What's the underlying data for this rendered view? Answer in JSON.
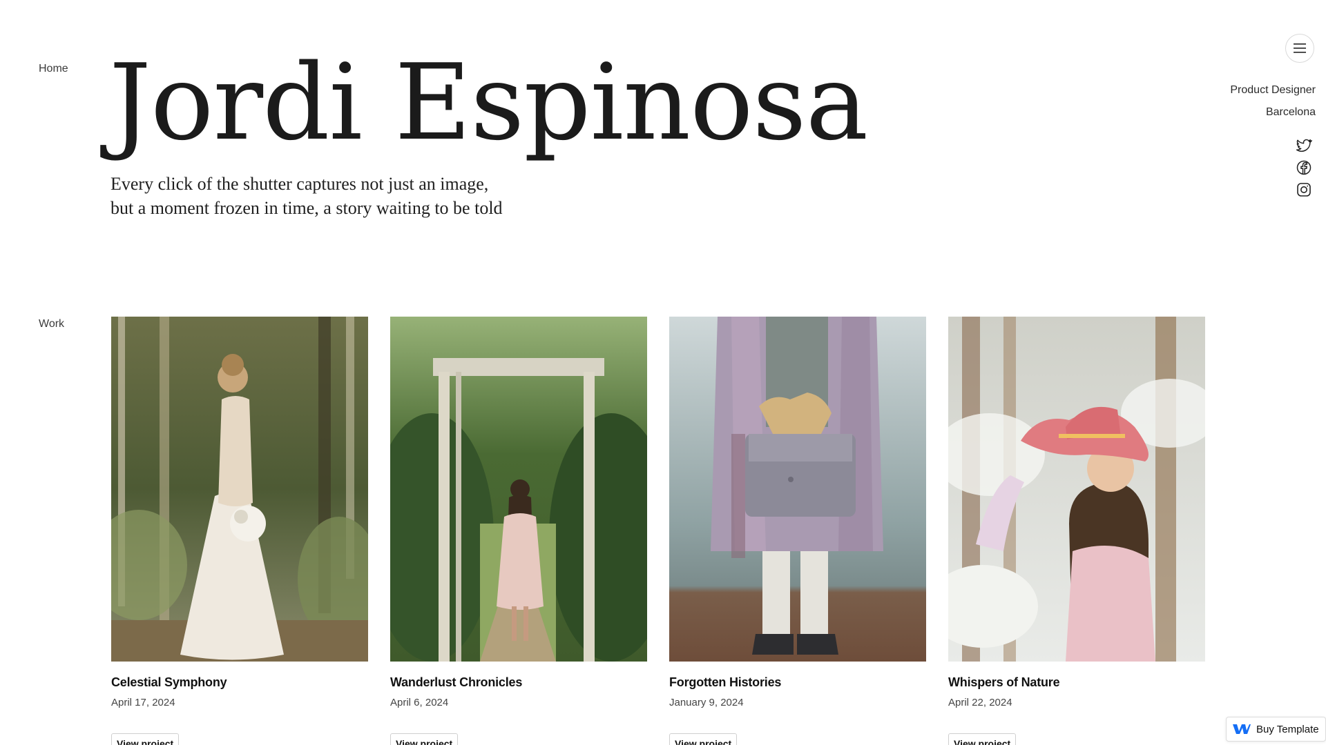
{
  "nav": {
    "home_label": "Home",
    "work_label": "Work",
    "menu_icon": "hamburger-menu-icon"
  },
  "hero": {
    "title": "Jordi Espinosa",
    "tagline_line1": "Every click of the shutter captures not just an image,",
    "tagline_line2": "but a moment frozen in time, a story waiting to be told"
  },
  "profile": {
    "role": "Product Designer",
    "location": "Barcelona"
  },
  "socials": [
    {
      "name": "twitter",
      "icon": "twitter-icon"
    },
    {
      "name": "facebook",
      "icon": "facebook-icon"
    },
    {
      "name": "instagram",
      "icon": "instagram-icon"
    }
  ],
  "projects": [
    {
      "title": "Celestial Symphony",
      "date": "April 17, 2024",
      "link_label": "View project"
    },
    {
      "title": "Wanderlust Chronicles",
      "date": "April 6, 2024",
      "link_label": "View project"
    },
    {
      "title": "Forgotten Histories",
      "date": "January 9, 2024",
      "link_label": "View project"
    },
    {
      "title": "Whispers of Nature",
      "date": "April 22, 2024",
      "link_label": "View project"
    }
  ],
  "badge": {
    "label": "Buy Template",
    "icon": "webflow-logo-icon",
    "brand_color": "#146ef5"
  },
  "colors": {
    "text": "#1b1b1b",
    "muted": "#444444",
    "border": "#d9d9d9"
  }
}
